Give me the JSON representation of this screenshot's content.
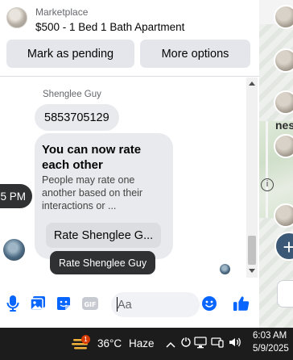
{
  "header": {
    "label": "Marketplace",
    "title": "$500 - 1 Bed 1 Bath Apartment",
    "mark_pending_label": "Mark as pending",
    "more_options_label": "More options"
  },
  "chat": {
    "sender_name": "Shenglee Guy",
    "phone_message": "5853705129",
    "rate_card": {
      "title": "You can now rate each other",
      "body": "People may rate one another based on their interactions or ...",
      "button_label": "Rate Shenglee G..."
    },
    "timestamp_partial": "5 PM",
    "tooltip": "Rate Shenglee Guy"
  },
  "right_panel": {
    "partial_text": "nest"
  },
  "composer": {
    "placeholder": "Aa",
    "icons": [
      "microphone-icon",
      "photo-icon",
      "sticker-icon",
      "gif-icon",
      "emoji-icon",
      "thumbs-up-icon"
    ]
  },
  "taskbar": {
    "weather_badge": "1",
    "temperature": "36°C",
    "weather_condition": "Haze",
    "time": "6:03 AM",
    "date": "5/9/2025"
  },
  "colors": {
    "accent_blue": "#0866ff",
    "bubble_gray": "#e9eaed",
    "button_gray": "#e4e6eb",
    "dark_pill": "#303133",
    "taskbar": "#1c1c1c"
  }
}
